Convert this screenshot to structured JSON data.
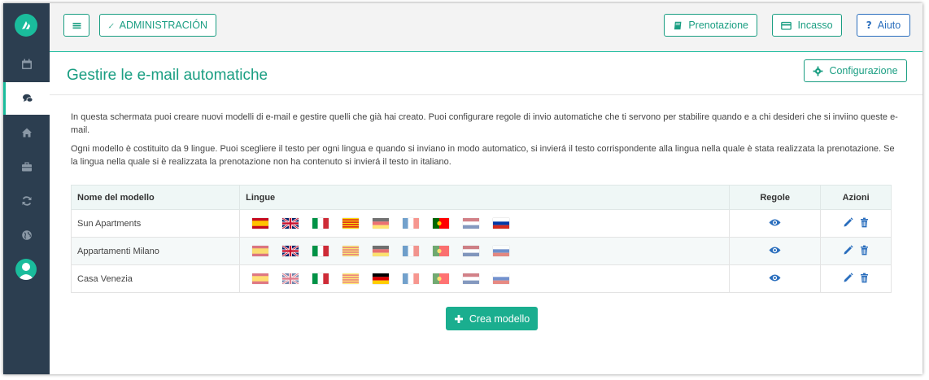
{
  "topbar": {
    "admin_label": "ADMINISTRACIÓN",
    "booking_label": "Prenotazione",
    "payments_label": "Incasso",
    "help_label": "Aiuto"
  },
  "page": {
    "title": "Gestire le e-mail automatiche",
    "config_label": "Configurazione",
    "description_1": "In questa schermata puoi creare nuovi modelli di e-mail e gestire quelli che già hai creato. Puoi configurare regole di invio automatiche che ti servono per stabilire quando e a chi desideri che si inviino queste e-mail.",
    "description_2": "Ogni modello è costituito da 9 lingue. Puoi scegliere il testo per ogni lingua e quando si inviano in modo automatico, si invierá il testo corrispondente alla lingua nella quale è stata realizzata la prenotazione. Se la lingua nella quale si è realizzata la prenotazione non ha contenuto si invierá il testo in italiano."
  },
  "table": {
    "headers": {
      "name": "Nome del modello",
      "languages": "Lingue",
      "rules": "Regole",
      "actions": "Azioni"
    },
    "rows": [
      {
        "name": "Sun Apartments",
        "languages_active": [
          true,
          true,
          true,
          true,
          false,
          false,
          true,
          false,
          true
        ]
      },
      {
        "name": "Appartamenti Milano",
        "languages_active": [
          false,
          true,
          true,
          false,
          false,
          false,
          false,
          false,
          false
        ]
      },
      {
        "name": "Casa Venezia",
        "languages_active": [
          false,
          false,
          true,
          false,
          true,
          false,
          false,
          false,
          false
        ]
      }
    ],
    "flag_icons": [
      "spain-flag-icon",
      "uk-flag-icon",
      "italy-flag-icon",
      "catalonia-flag-icon",
      "germany-flag-icon",
      "france-flag-icon",
      "portugal-flag-icon",
      "netherlands-flag-icon",
      "russia-flag-icon"
    ]
  },
  "create_label": "Crea modello",
  "colors": {
    "accent": "#1abc9c",
    "sidebar": "#2c3e50",
    "link_blue": "#2a6ebd"
  }
}
